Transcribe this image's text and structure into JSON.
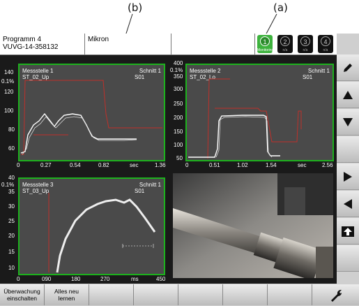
{
  "annotations": {
    "b": "(b)",
    "a": "(a)"
  },
  "header": {
    "program_line1": "Programm 4",
    "program_line2": "VUVG-14-358132",
    "tool_name": "Mikron",
    "status": [
      {
        "num": "1",
        "label": "Monitoring",
        "active": true
      },
      {
        "num": "2",
        "label": "n/a",
        "active": false
      },
      {
        "num": "3",
        "label": "n/a",
        "active": false
      },
      {
        "num": "4",
        "label": "n/a",
        "active": false
      }
    ]
  },
  "panel1": {
    "title": "Messstelle 1",
    "sensor": "ST_02_Up",
    "cut": "Schnitt 1",
    "cut_id": "S01",
    "y_ticks": [
      "140",
      "0.1%",
      "120",
      "100",
      "80",
      "60"
    ],
    "x_ticks": [
      "0",
      "0.27",
      "0.54",
      "0.82",
      "sec",
      "1.36"
    ]
  },
  "panel2": {
    "title": "Messstelle 2",
    "sensor": "ST_02_Lo",
    "cut": "Schnitt 1",
    "cut_id": "S01",
    "y_ticks": [
      "400",
      "0.1%",
      "350",
      "300",
      "250",
      "200",
      "150",
      "100",
      "50"
    ],
    "x_ticks": [
      "0",
      "0.51",
      "1.02",
      "1.54",
      "sec",
      "2.56"
    ]
  },
  "panel3": {
    "title": "Messstelle 3",
    "sensor": "ST_03_Up",
    "cut": "Schnitt 1",
    "cut_id": "S01",
    "y_ticks": [
      "40",
      "0.1%",
      "35",
      "30",
      "25",
      "20",
      "15",
      "10"
    ],
    "x_ticks": [
      "0",
      "090",
      "180",
      "270",
      "ms",
      "450"
    ]
  },
  "bottom": {
    "btn1": "Überwachung einschalten",
    "btn2": "Alles neu lernen"
  },
  "colors": {
    "panel_border": "#1db21d",
    "limit_line": "#c0302a",
    "signal": "#ffffff"
  }
}
